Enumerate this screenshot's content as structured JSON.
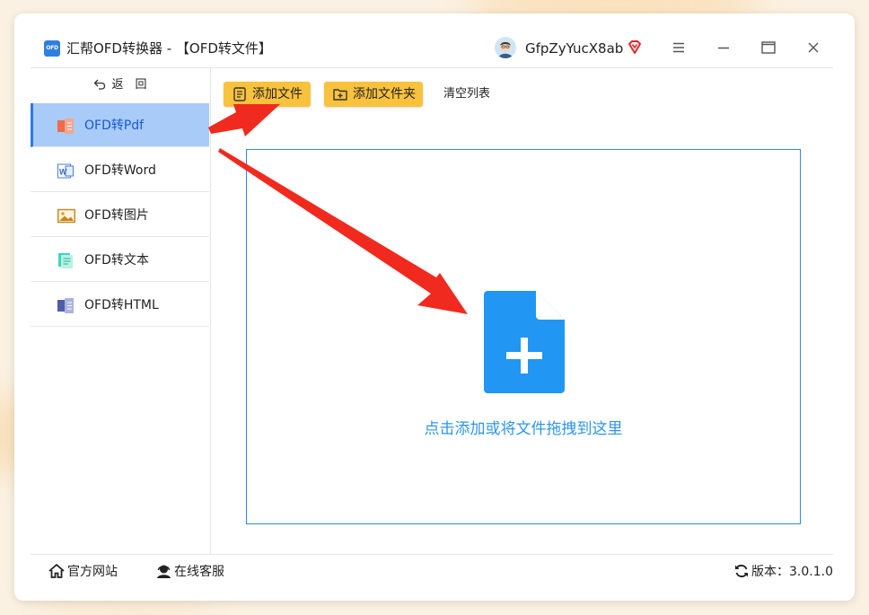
{
  "app": {
    "logo_text": "OFD",
    "title": "汇帮OFD转换器 - 【OFD转文件】"
  },
  "user": {
    "name": "GfpZyYucX8ab",
    "vip_icon": "diamond-icon"
  },
  "sidebar": {
    "back_label": "返　回",
    "items": [
      {
        "label": "OFD转Pdf",
        "icon": "pdf-icon",
        "active": true
      },
      {
        "label": "OFD转Word",
        "icon": "word-icon",
        "active": false
      },
      {
        "label": "OFD转图片",
        "icon": "image-icon",
        "active": false
      },
      {
        "label": "OFD转文本",
        "icon": "text-icon",
        "active": false
      },
      {
        "label": "OFD转HTML",
        "icon": "html-icon",
        "active": false
      }
    ]
  },
  "toolbar": {
    "add_file_label": "添加文件",
    "add_folder_label": "添加文件夹",
    "clear_label": "清空列表"
  },
  "dropzone": {
    "text": "点击添加或将文件拖拽到这里"
  },
  "statusbar": {
    "site_label": "官方网站",
    "service_label": "在线客服",
    "version_label": "版本：3.0.1.0"
  },
  "colors": {
    "accent_blue": "#2f95e9",
    "button_yellow": "#f9c23c",
    "active_bg": "#a8cbf7",
    "arrow_red": "#f02a1e"
  }
}
